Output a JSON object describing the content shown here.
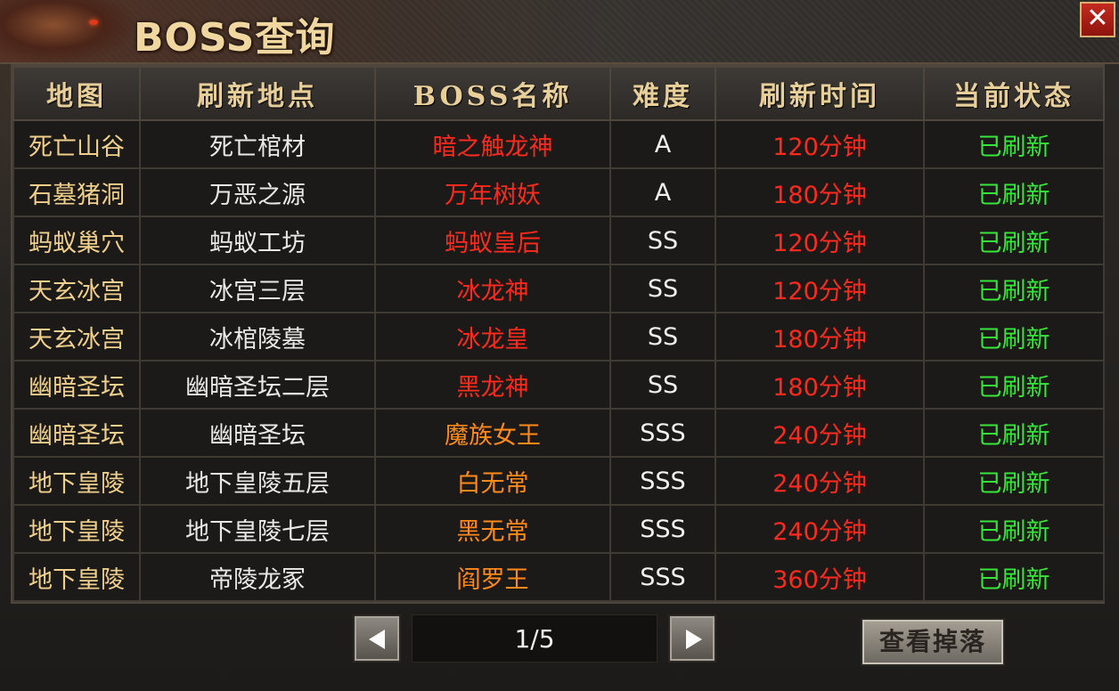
{
  "window": {
    "title": "BOSS查询",
    "close_label": "✕"
  },
  "colors": {
    "boss_red": "#ff2a1e",
    "boss_orange": "#ff8a1a",
    "status_green": "#36e63a",
    "map_gold": "#efcf8c"
  },
  "table": {
    "headers": [
      "地图",
      "刷新地点",
      "BOSS名称",
      "难度",
      "刷新时间",
      "当前状态"
    ],
    "rows": [
      {
        "map": "死亡山谷",
        "location": "死亡棺材",
        "boss": "暗之触龙神",
        "difficulty": "A",
        "refresh": "120分钟",
        "status": "已刷新",
        "boss_color": "#ff2a1e"
      },
      {
        "map": "石墓猪洞",
        "location": "万恶之源",
        "boss": "万年树妖",
        "difficulty": "A",
        "refresh": "180分钟",
        "status": "已刷新",
        "boss_color": "#ff2a1e"
      },
      {
        "map": "蚂蚁巢穴",
        "location": "蚂蚁工坊",
        "boss": "蚂蚁皇后",
        "difficulty": "SS",
        "refresh": "120分钟",
        "status": "已刷新",
        "boss_color": "#ff2a1e"
      },
      {
        "map": "天玄冰宫",
        "location": "冰宫三层",
        "boss": "冰龙神",
        "difficulty": "SS",
        "refresh": "120分钟",
        "status": "已刷新",
        "boss_color": "#ff2a1e"
      },
      {
        "map": "天玄冰宫",
        "location": "冰棺陵墓",
        "boss": "冰龙皇",
        "difficulty": "SS",
        "refresh": "180分钟",
        "status": "已刷新",
        "boss_color": "#ff2a1e"
      },
      {
        "map": "幽暗圣坛",
        "location": "幽暗圣坛二层",
        "boss": "黑龙神",
        "difficulty": "SS",
        "refresh": "180分钟",
        "status": "已刷新",
        "boss_color": "#ff2a1e"
      },
      {
        "map": "幽暗圣坛",
        "location": "幽暗圣坛",
        "boss": "魔族女王",
        "difficulty": "SSS",
        "refresh": "240分钟",
        "status": "已刷新",
        "boss_color": "#ff8a1a"
      },
      {
        "map": "地下皇陵",
        "location": "地下皇陵五层",
        "boss": "白无常",
        "difficulty": "SSS",
        "refresh": "240分钟",
        "status": "已刷新",
        "boss_color": "#ff8a1a"
      },
      {
        "map": "地下皇陵",
        "location": "地下皇陵七层",
        "boss": "黑无常",
        "difficulty": "SSS",
        "refresh": "240分钟",
        "status": "已刷新",
        "boss_color": "#ff8a1a"
      },
      {
        "map": "地下皇陵",
        "location": "帝陵龙冢",
        "boss": "阎罗王",
        "difficulty": "SSS",
        "refresh": "360分钟",
        "status": "已刷新",
        "boss_color": "#ff8a1a"
      }
    ]
  },
  "pagination": {
    "page_text": "1/5",
    "prev_icon": "arrow-left-icon",
    "next_icon": "arrow-right-icon"
  },
  "actions": {
    "view_drops_label": "查看掉落"
  }
}
